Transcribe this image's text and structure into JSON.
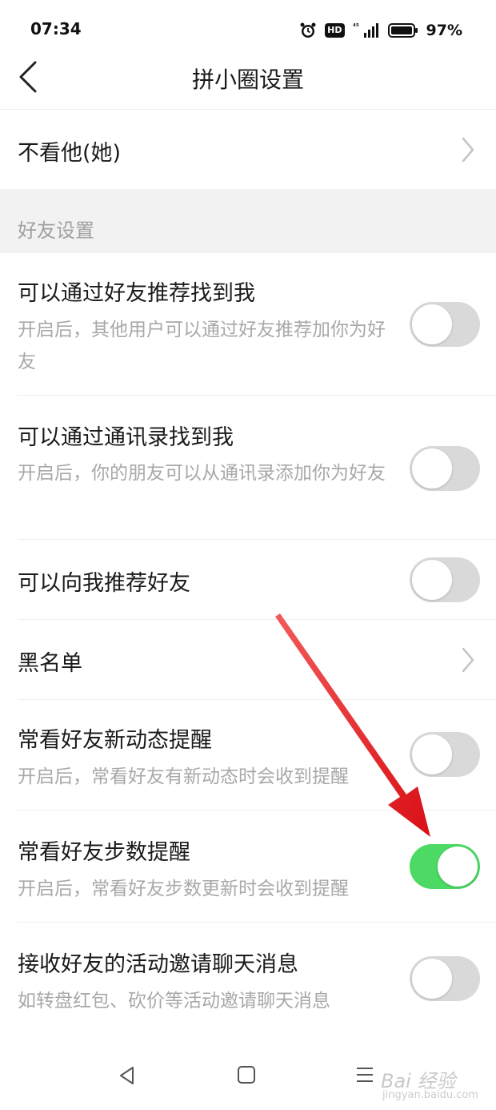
{
  "status_bar": {
    "time": "07:34",
    "hd_badge": "HD",
    "battery_percent": "97%",
    "icons": [
      "alarm-icon",
      "signal-5g-icon",
      "battery-icon"
    ]
  },
  "nav": {
    "title": "拼小圈设置",
    "back_icon": "chevron-left-icon"
  },
  "rows": {
    "hide_him": {
      "title": "不看他(她)"
    },
    "section_friends": "好友设置",
    "find_by_recommend": {
      "title": "可以通过好友推荐找到我",
      "subtitle": "开启后，其他用户可以通过好友推荐加你为好友",
      "enabled": false
    },
    "find_by_contacts": {
      "title": "可以通过通讯录找到我",
      "subtitle": "开启后，你的朋友可以从通讯录添加你为好友",
      "enabled": false
    },
    "recommend_to_me": {
      "title": "可以向我推荐好友",
      "enabled": false
    },
    "blacklist": {
      "title": "黑名单"
    },
    "frequent_updates": {
      "title": "常看好友新动态提醒",
      "subtitle": "开启后，常看好友有新动态时会收到提醒",
      "enabled": false
    },
    "frequent_steps": {
      "title": "常看好友步数提醒",
      "subtitle": "开启后，常看好友步数更新时会收到提醒",
      "enabled": true
    },
    "activity_invites": {
      "title": "接收好友的活动邀请聊天消息",
      "subtitle": "如转盘红包、砍价等活动邀请聊天消息",
      "enabled": false
    }
  },
  "colors": {
    "toggle_on": "#4cd964",
    "toggle_off": "#d9d9d9",
    "section_bg": "#f2f2f2",
    "annotation_arrow": "#e8141c"
  },
  "watermark": {
    "brand": "Bai 经验",
    "url": "jingyan.baidu.com"
  }
}
